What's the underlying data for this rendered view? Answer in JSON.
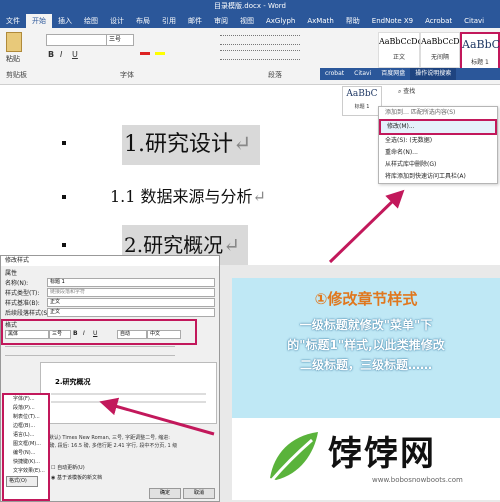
{
  "window": {
    "title": "目录模版.docx - Word"
  },
  "ribbon_tabs": [
    "文件",
    "开始",
    "插入",
    "绘图",
    "设计",
    "布局",
    "引用",
    "邮件",
    "审阅",
    "视图",
    "AxGlyph",
    "AxMath",
    "帮助",
    "EndNote X9",
    "Acrobat",
    "Citavi"
  ],
  "ribbon": {
    "paste_label": "粘贴",
    "clipboard_label": "剪贴板",
    "font_group_label": "字体",
    "paragraph_group_label": "段落",
    "font_name": "",
    "font_size": "三号",
    "bold": "B",
    "italic": "I",
    "underline": "U",
    "styles": [
      {
        "preview": "AaBbCcDc",
        "name": "正文"
      },
      {
        "preview": "AaBbCcDc",
        "name": "无间隔"
      },
      {
        "preview": "AaBbC",
        "name": "标题 1"
      }
    ]
  },
  "strip2": {
    "items": [
      "crobat",
      "Citavi",
      "百度网盘",
      "操作说明搜索"
    ]
  },
  "doc": {
    "h1": "1.研究设计",
    "h2": "1.1 数据来源与分析",
    "h3": "2.研究概况",
    "para_mark": "↵"
  },
  "style_thumbnail": {
    "preview": "AaBbC",
    "name": "标题 1"
  },
  "style_pane": {
    "find": "查找"
  },
  "context_menu": {
    "top_hint": "添加到… 匹配所选内容(S)",
    "items": [
      "修改(M)...",
      "全选(S): (无数据)",
      "重命名(N)...",
      "从样式库中删除(G)",
      "将库添加到快速访问工具栏(A)"
    ]
  },
  "dialog": {
    "title": "修改样式",
    "section_props": "属性",
    "name_label": "名称(N):",
    "name_value": "标题 1",
    "type_label": "样式类型(T):",
    "type_value": "链接段落和字符",
    "based_label": "样式基准(B):",
    "based_value": "正文",
    "next_label": "后续段落样式(S):",
    "next_value": "正文",
    "format_label": "格式",
    "font_value": "黑体",
    "size_value": "三号",
    "bold": "B",
    "italic": "I",
    "underline": "U",
    "color_value": "自动",
    "lang_value": "中文",
    "preview_heading": "2.研究概况",
    "desc_1": "字体: (中文) 黑体, (默认) Times New Roman, 三号, 字距调整二号, 缩进:",
    "desc_2": "段落间距: 段前: 17 磅, 段后: 16.5 磅, 多倍行距 2.41 字行, 段中不分页, 1 级",
    "auto_update": "自动更新(U)",
    "template_opt": "基于该模板的新文档",
    "format_button": "格式(O)",
    "ok_button": "确定",
    "cancel_button": "取消"
  },
  "format_submenu": {
    "items": [
      "字体(F)...",
      "段落(P)...",
      "制表位(T)...",
      "边框(B)...",
      "语言(L)...",
      "图文框(M)...",
      "编号(N)...",
      "快捷键(K)...",
      "文字效果(E)..."
    ]
  },
  "callout": {
    "title": "①修改章节样式",
    "lines": [
      "一级标题就修改\"菜单\"下",
      "的\"标题1\"样式,以此类推修改",
      "二级标题，三级标题……"
    ]
  },
  "logo": {
    "text": "饽饽网",
    "url": "www.bobosnowboots.com"
  },
  "colors": {
    "word_blue": "#2b579a",
    "highlight_pink": "#c2185b",
    "callout_bg": "#bfe8f5",
    "callout_title": "#e0771d",
    "logo_green": "#5ab33b"
  }
}
